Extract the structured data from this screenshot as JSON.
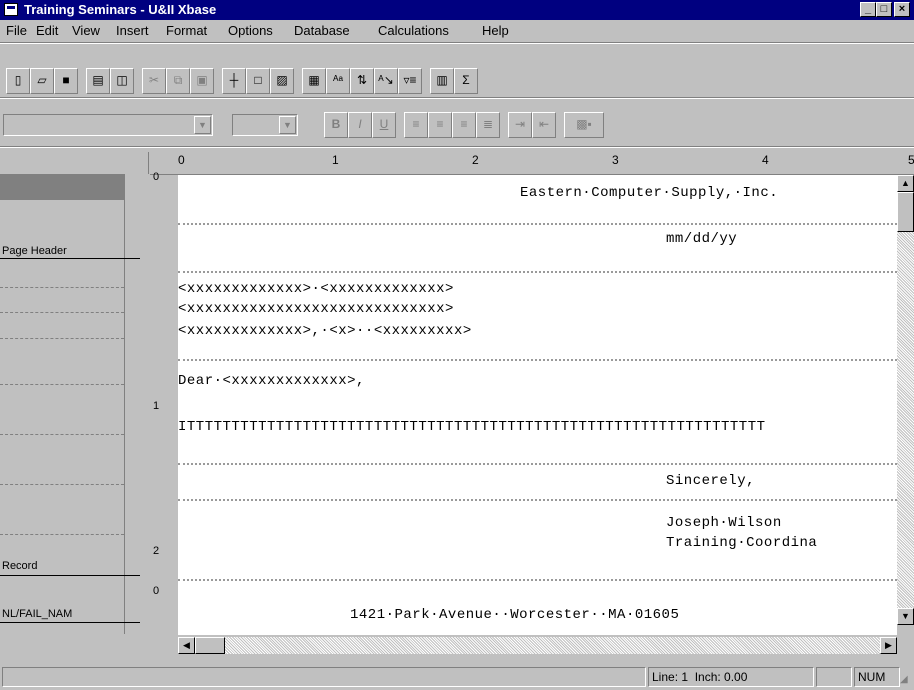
{
  "window": {
    "title": "Training Seminars - U&II Xbase",
    "buttons": {
      "minimize": "_",
      "maximize": "□",
      "close": "×"
    }
  },
  "menu": [
    "File",
    "Edit",
    "View",
    "Insert",
    "Format",
    "Options",
    "Database",
    "Calculations",
    "Help"
  ],
  "toolbar1": {
    "icons": [
      "new-icon",
      "open-icon",
      "save-icon",
      "print-icon",
      "print-preview-icon",
      "cut-icon",
      "copy-icon",
      "paste-icon",
      "line-icon",
      "box-icon",
      "picture-icon",
      "table-icon",
      "field-icon",
      "sort-icon",
      "abc-icon",
      "filter-icon",
      "calculator-icon",
      "sum-icon"
    ],
    "sum_label": "Σ"
  },
  "toolbar2": {
    "font_value": "",
    "size_value": "",
    "bold": "B",
    "italic": "I",
    "underline": "U"
  },
  "band_labels": {
    "page_header": "Page Header",
    "record": "Record",
    "field": "NL/FAIL_NAM"
  },
  "ruler": {
    "top": [
      "0",
      "1",
      "2",
      "3",
      "4",
      "5"
    ],
    "left": [
      "0",
      "1",
      "2",
      "0"
    ]
  },
  "document": {
    "company": "Eastern·Computer·Supply,·Inc.",
    "date": "mm/dd/yy",
    "address1": "<xxxxxxxxxxxxx>·<xxxxxxxxxxxxx>",
    "address2": "<xxxxxxxxxxxxxxxxxxxxxxxxxxxxx>",
    "address3": "<xxxxxxxxxxxxx>,·<x>··<xxxxxxxxx>",
    "salutation": "Dear·<xxxxxxxxxxxxx>,",
    "body": "ITTTTTTTTTTTTTTTTTTTTTTTTTTTTTTTTTTTTTTTTTTTTTTTTTTTTTTTTTTTTTTTTT",
    "closing": "Sincerely,",
    "signer": "Joseph·Wilson",
    "signer_title": "Training·Coordina",
    "footer": "1421·Park·Avenue··Worcester··MA·01605"
  },
  "status": {
    "line": "Line: 1",
    "inch": "Inch: 0.00",
    "num": "NUM"
  }
}
